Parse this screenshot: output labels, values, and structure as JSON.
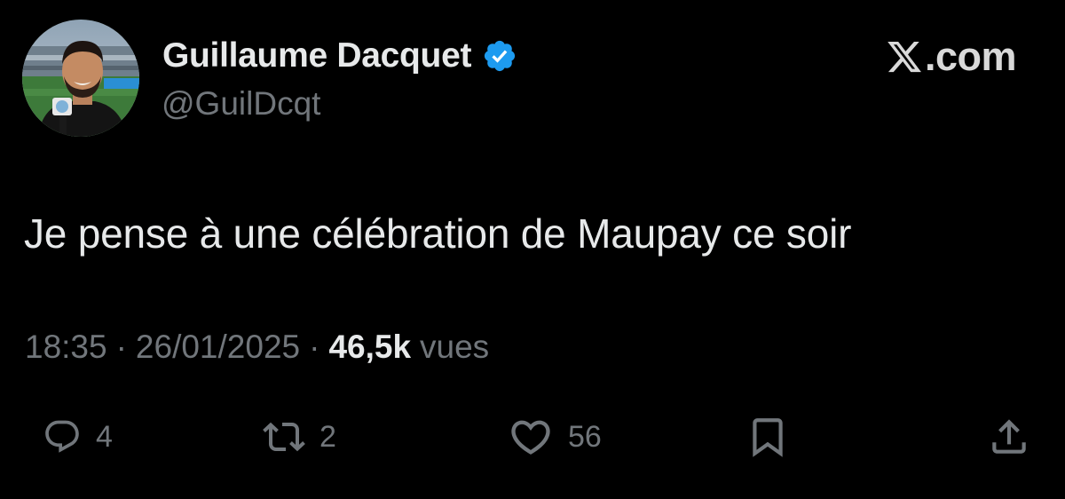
{
  "author": {
    "display_name": "Guillaume Dacquet",
    "handle": "@GuilDcqt",
    "verified": true
  },
  "brand": {
    "text": ".com",
    "icon": "x-logo-icon"
  },
  "tweet": {
    "text": "Je pense à une célébration de Maupay ce soir",
    "time": "18:35",
    "separator": "·",
    "date": "26/01/2025",
    "views_count": "46,5k",
    "views_label": "vues"
  },
  "actions": {
    "reply": {
      "icon": "reply-icon",
      "count": "4"
    },
    "repost": {
      "icon": "repost-icon",
      "count": "2"
    },
    "like": {
      "icon": "heart-icon",
      "count": "56"
    },
    "bookmark": {
      "icon": "bookmark-icon"
    },
    "share": {
      "icon": "share-icon"
    }
  },
  "colors": {
    "background": "#000000",
    "primary_text": "#e7e9ea",
    "secondary_text": "#71767b",
    "verified_badge": "#1d9bf0"
  }
}
